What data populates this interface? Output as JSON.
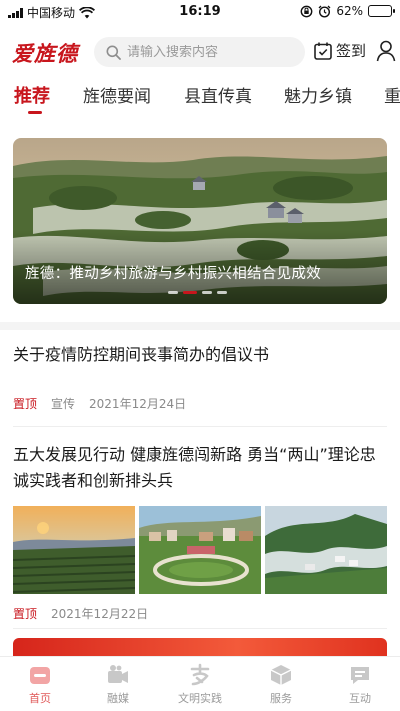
{
  "status_bar": {
    "carrier": "中国移动",
    "time": "16:19",
    "battery_percent": "62%",
    "battery_level": 0.62
  },
  "header": {
    "logo": "爱旌德",
    "search_placeholder": "请输入搜索内容",
    "signin_label": "签到"
  },
  "tabs": [
    "推荐",
    "旌德要闻",
    "县直传真",
    "魅力乡镇",
    "重"
  ],
  "banner": {
    "caption": "旌德：推动乡村旅游与乡村振兴相结合见成效",
    "slide_count": 4,
    "active_slide": 2
  },
  "news": [
    {
      "title": "关于疫情防控期间丧事简办的倡议书",
      "tag": "置顶",
      "source": "宣传",
      "date": "2021年12月24日"
    },
    {
      "title": "五大发展见行动 健康旌德闯新路 勇当“两山”理论忠诚实践者和创新排头兵",
      "tag": "置顶",
      "source": "",
      "date": "2021年12月22日"
    }
  ],
  "bottom_nav": [
    "首页",
    "融媒",
    "文明实践",
    "服务",
    "互动"
  ],
  "colors": {
    "accent": "#c8161d",
    "nav_active": "#e05b5b",
    "muted": "#8a8a8a"
  }
}
